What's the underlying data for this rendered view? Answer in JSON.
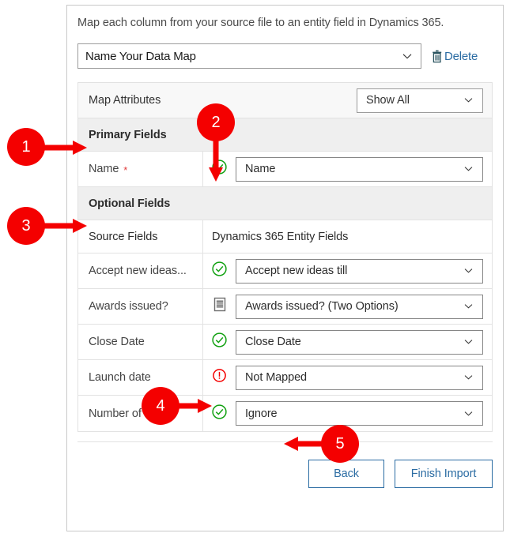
{
  "dialog": {
    "intro": "Map each column from your source file to an entity field in Dynamics 365.",
    "map_name": {
      "value": "Name Your Data Map",
      "chevron_icon": "chevron-down-icon"
    },
    "delete": {
      "label": "Delete",
      "icon": "trash-icon",
      "color": "#2b6ca3"
    }
  },
  "table": {
    "map_attributes": {
      "label": "Map Attributes",
      "filter": {
        "value": "Show All",
        "chevron_icon": "chevron-down-icon"
      }
    },
    "sections": {
      "primary": "Primary Fields",
      "optional": "Optional Fields"
    },
    "columns": {
      "source": "Source Fields",
      "target": "Dynamics 365 Entity Fields"
    },
    "primary_rows": [
      {
        "source": "Name",
        "required": true,
        "required_mark": "*",
        "status_icon": "check-circle-icon",
        "status_color": "#12a112",
        "target": "Name"
      }
    ],
    "optional_rows": [
      {
        "source": "Accept new ideas...",
        "required": false,
        "status_icon": "check-circle-icon",
        "status_color": "#12a112",
        "target": "Accept new ideas till"
      },
      {
        "source": "Awards issued?",
        "required": false,
        "status_icon": "list-document-icon",
        "status_color": "#6e6e6e",
        "target": "Awards issued? (Two Options)"
      },
      {
        "source": "Close Date",
        "required": false,
        "status_icon": "check-circle-icon",
        "status_color": "#12a112",
        "target": "Close Date"
      },
      {
        "source": "Launch date",
        "required": false,
        "status_icon": "error-circle-icon",
        "status_color": "#f40000",
        "target": "Not Mapped"
      },
      {
        "source": "Number of ideas",
        "required": false,
        "status_icon": "check-circle-icon",
        "status_color": "#12a112",
        "target": "Ignore"
      }
    ]
  },
  "footer": {
    "back_label": "Back",
    "finish_label": "Finish Import"
  },
  "callouts": [
    {
      "number": "1"
    },
    {
      "number": "2"
    },
    {
      "number": "3"
    },
    {
      "number": "4"
    },
    {
      "number": "5"
    }
  ]
}
